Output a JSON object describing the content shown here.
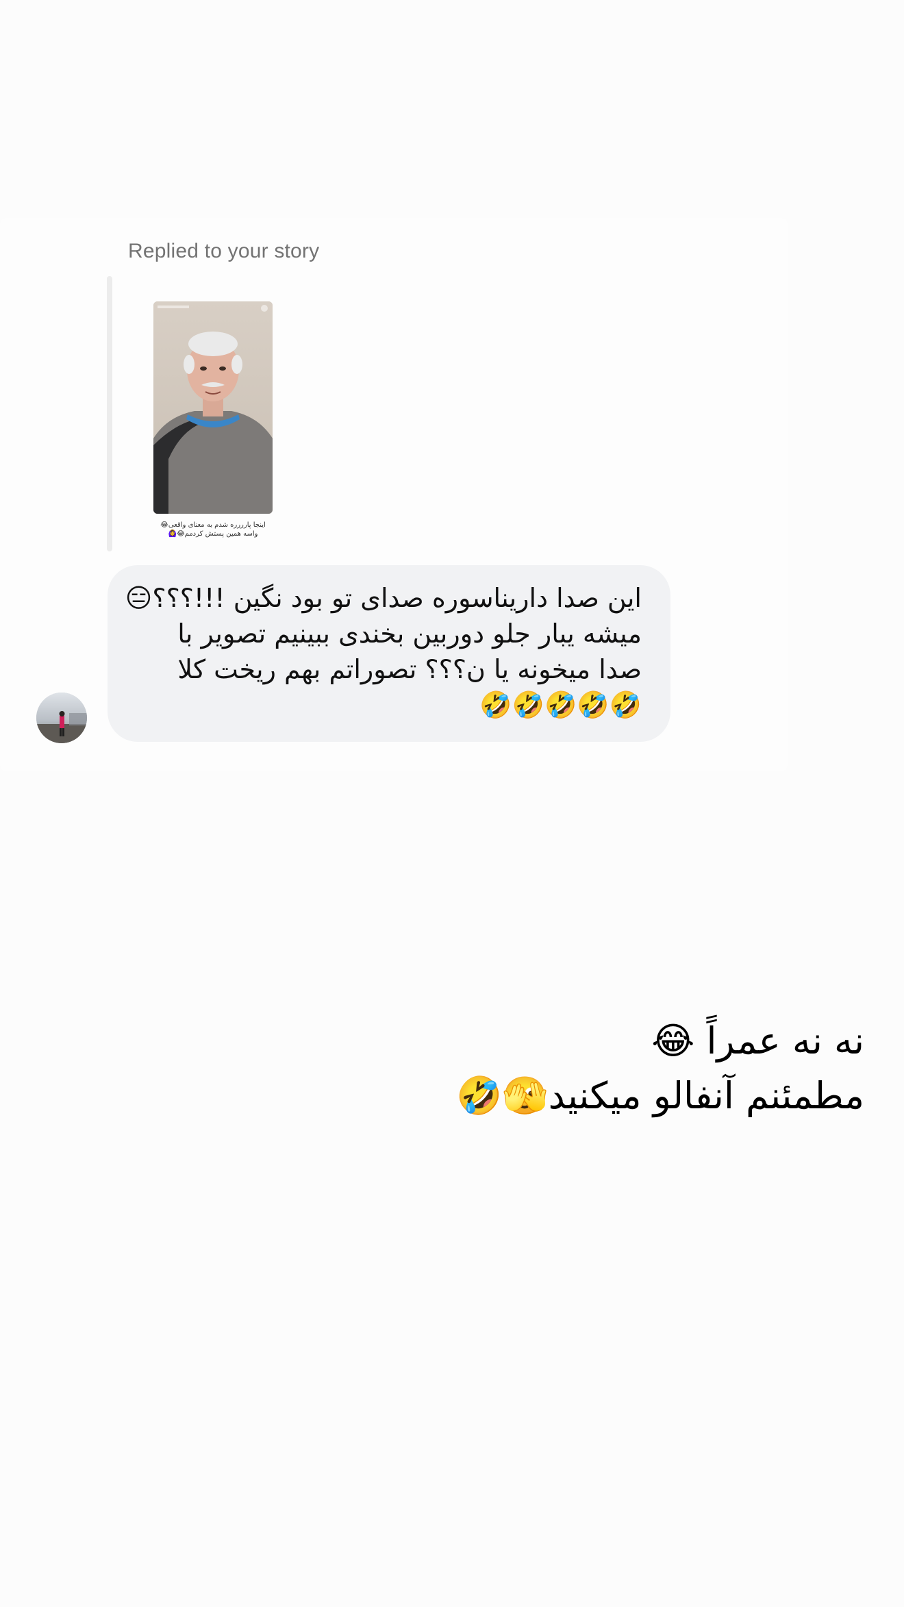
{
  "story_reply": {
    "label": "Replied to your story",
    "story_caption_line1": "اینجا پارررره شدم به معنای واقعی😂",
    "story_caption_line2": "واسه همین پستش کردمم😂🙆‍♀️"
  },
  "incoming_message": {
    "lines": [
      "این صدا داریناسوره صدای تو بود نگین !!!؟؟؟😑",
      "میشه یبار جلو دوربین بخندی ببینیم تصویر با",
      "صدا  میخونه یا ن؟؟؟ تصوراتم بهم ریخت کلا",
      "🤣🤣🤣🤣🤣"
    ]
  },
  "outgoing_message": {
    "lines": [
      "نه نه عمراً 😂",
      "مطمئنم آنفالو میکنید🫣🤣"
    ]
  },
  "icons": {
    "avatar": "sender-avatar",
    "story": "story-thumbnail"
  }
}
